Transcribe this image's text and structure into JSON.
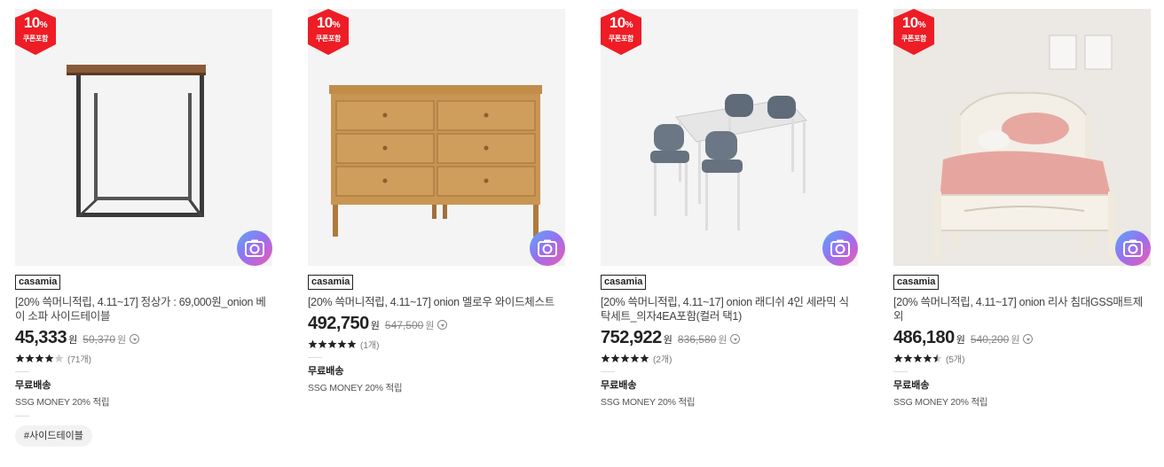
{
  "products": [
    {
      "coupon": {
        "percent": "10",
        "unit": "%",
        "label": "쿠폰포함"
      },
      "brand": "casamia",
      "title": "[20% 쓱머니적립, 4.11~17] 정상가 : 69,000원_onion 베이 소파 사이드테이블",
      "price": "45,333",
      "won": "원",
      "original_price": "50,370",
      "original_won": "원",
      "rating_stars": 4,
      "rating_count": "(71개)",
      "shipping": "무료배송",
      "ssg": "SSG MONEY 20% 적립",
      "tag": "#사이드테이블",
      "thumb_bg": "#f4f4f4"
    },
    {
      "coupon": {
        "percent": "10",
        "unit": "%",
        "label": "쿠폰포함"
      },
      "brand": "casamia",
      "title": "[20% 쓱머니적립, 4.11~17] onion 멜로우 와이드체스트",
      "price": "492,750",
      "won": "원",
      "original_price": "547,500",
      "original_won": "원",
      "rating_stars": 5,
      "rating_count": "(1개)",
      "shipping": "무료배송",
      "ssg": "SSG MONEY 20% 적립",
      "thumb_bg": "#f4f4f4"
    },
    {
      "coupon": {
        "percent": "10",
        "unit": "%",
        "label": "쿠폰포함"
      },
      "brand": "casamia",
      "title": "[20% 쓱머니적립, 4.11~17] onion 래디쉬 4인 세라믹 식탁세트_의자4EA포함(컬러 택1)",
      "price": "752,922",
      "won": "원",
      "original_price": "836,580",
      "original_won": "원",
      "rating_stars": 5,
      "rating_count": "(2개)",
      "shipping": "무료배송",
      "ssg": "SSG MONEY 20% 적립",
      "thumb_bg": "#f4f4f4"
    },
    {
      "coupon": {
        "percent": "10",
        "unit": "%",
        "label": "쿠폰포함"
      },
      "brand": "casamia",
      "title": "[20% 쓱머니적립, 4.11~17] onion 리사 침대GSS매트제외",
      "price": "486,180",
      "won": "원",
      "original_price": "540,200",
      "original_won": "원",
      "rating_stars": 4.5,
      "rating_count": "(5개)",
      "shipping": "무료배송",
      "ssg": "SSG MONEY 20% 적립",
      "thumb_bg": "#ece8e3"
    }
  ],
  "colors": {
    "coupon_red": "#ee1c25",
    "star": "#222222",
    "star_empty": "#cccccc"
  },
  "icons": {
    "camera": "camera-icon",
    "info": "info-circle-icon",
    "star": "star-icon"
  }
}
